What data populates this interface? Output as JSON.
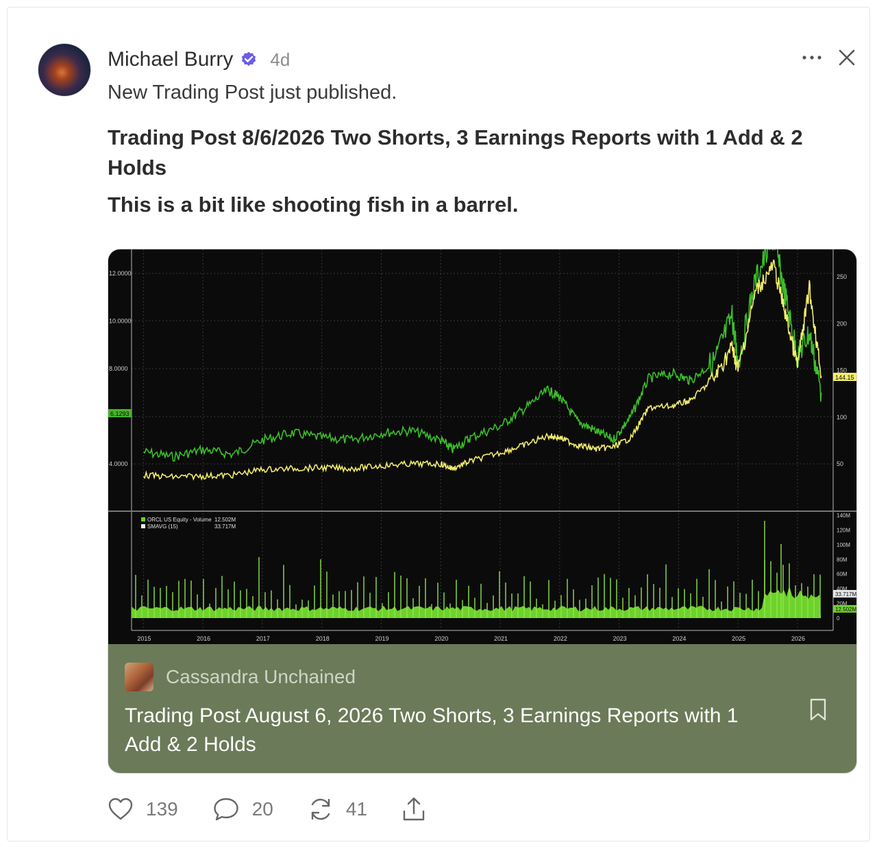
{
  "post": {
    "author": "Michael Burry",
    "time": "4d",
    "intro": "New Trading Post just published.",
    "title": "Trading Post 8/6/2026 Two Shorts, 3 Earnings Reports with 1 Add & 2 Holds",
    "subtitle": "This is a bit like shooting fish in a barrel."
  },
  "embed": {
    "publication": "Cassandra Unchained",
    "title": "Trading Post August 6, 2026 Two Shorts, 3 Earnings Reports with 1 Add & 2 Holds"
  },
  "actions": {
    "likes": "139",
    "comments": "20",
    "restacks": "41"
  },
  "colors": {
    "verified": "#6c5ce7",
    "embed_bg": "#6b7a58",
    "chart_bg": "#0b0b0b",
    "price_green": "#3bbf2a",
    "price_yellow": "#f2ec6c",
    "volume_green": "#6ed12c"
  },
  "icons": [
    "verified-icon",
    "more-icon",
    "close-icon",
    "bookmark-icon",
    "heart-icon",
    "comment-icon",
    "restack-icon",
    "share-icon"
  ],
  "chart_data": {
    "type": "line",
    "x_ticks": [
      "2015",
      "2016",
      "2017",
      "2018",
      "2019",
      "2020",
      "2021",
      "2022",
      "2023",
      "2024",
      "2025",
      "2026"
    ],
    "left_axis": {
      "ticks": [
        "12.0000",
        "10.0000",
        "8.0000",
        "4.0000"
      ],
      "marker": "6.1293"
    },
    "right_axis": {
      "ticks": [
        "250",
        "200",
        "150",
        "100",
        "50"
      ],
      "marker": "144.15"
    },
    "volume_axis": {
      "ticks": [
        "140M",
        "120M",
        "100M",
        "80M",
        "60M",
        "40M",
        "20M",
        "0"
      ],
      "markers": [
        "33.717M",
        "12.502M"
      ]
    },
    "volume_legend": [
      {
        "label": "ORCL US Equity - Volume",
        "value": "12.502M"
      },
      {
        "label": "SMAVG (15)",
        "value": "33.717M"
      }
    ],
    "series": [
      {
        "x": [
          2015.0,
          2015.5,
          2016.0,
          2016.5,
          2017.0,
          2017.5,
          2018.0,
          2018.5,
          2019.0,
          2019.5,
          2020.0,
          2020.2,
          2020.5,
          2021.0,
          2021.4,
          2021.8,
          2022.0,
          2022.3,
          2022.6,
          2022.9,
          2023.2,
          2023.5,
          2023.9,
          2024.2,
          2024.6,
          2024.9,
          2025.0,
          2025.3,
          2025.6,
          2025.8,
          2026.0,
          2026.2,
          2026.4
        ],
        "y": [
          4.5,
          4.3,
          4.6,
          4.4,
          5.0,
          5.3,
          5.1,
          5.0,
          5.3,
          5.4,
          5.0,
          4.6,
          5.1,
          5.6,
          6.3,
          7.1,
          6.8,
          5.8,
          5.4,
          5.0,
          6.0,
          7.6,
          7.8,
          7.5,
          8.3,
          10.2,
          8.2,
          11.8,
          13.5,
          11.0,
          8.5,
          9.5,
          7.0
        ]
      },
      {
        "x": [
          2015.0,
          2015.5,
          2016.0,
          2016.5,
          2017.0,
          2017.5,
          2018.0,
          2018.5,
          2019.0,
          2019.5,
          2020.0,
          2020.2,
          2020.5,
          2021.0,
          2021.4,
          2021.8,
          2022.0,
          2022.3,
          2022.6,
          2022.9,
          2023.2,
          2023.5,
          2023.9,
          2024.2,
          2024.6,
          2024.9,
          2025.0,
          2025.3,
          2025.6,
          2025.8,
          2026.0,
          2026.2,
          2026.4
        ],
        "y": [
          38,
          36,
          37,
          38,
          44,
          45,
          46,
          45,
          48,
          50,
          50,
          45,
          53,
          62,
          70,
          80,
          78,
          70,
          66,
          68,
          78,
          110,
          112,
          118,
          142,
          175,
          150,
          235,
          262,
          210,
          155,
          238,
          144.15
        ]
      }
    ]
  }
}
